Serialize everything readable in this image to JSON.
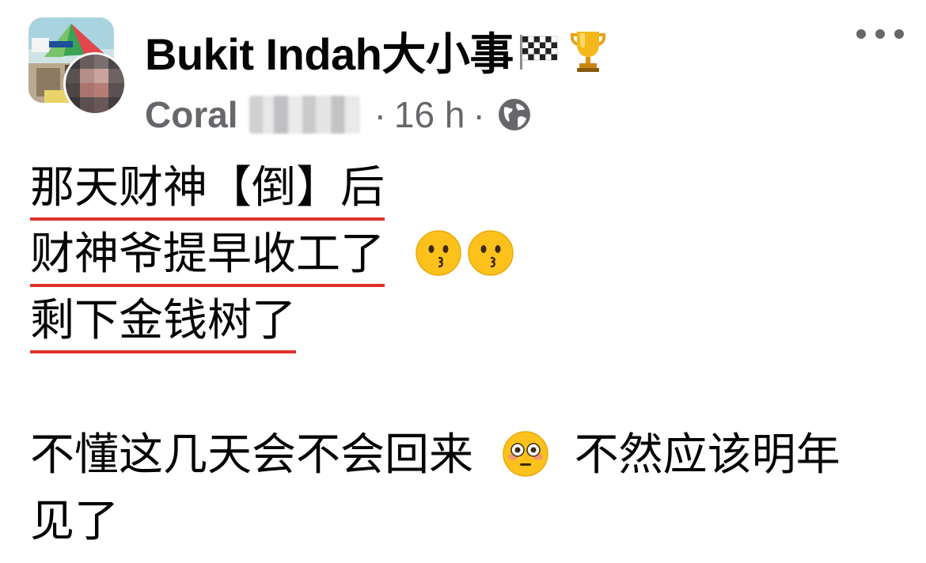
{
  "header": {
    "group_name": "Bukit Indah大小事",
    "author_first_name": "Coral",
    "timestamp": "16 h",
    "separator": "·",
    "icons": {
      "group_avatar": "group-avatar-image",
      "user_avatar": "user-avatar-blurred",
      "flag": "chequered-flag-emoji",
      "trophy": "trophy-emoji",
      "privacy": "globe-icon",
      "more": "more-options-icon"
    }
  },
  "post": {
    "lines": [
      "那天财神【倒】后",
      "财神爷提早收工了",
      "剩下金钱树了",
      "不懂这几天会不会回来",
      "不然应该明年",
      "见了"
    ],
    "emojis": {
      "line2": [
        "kissing-face-emoji",
        "kissing-face-emoji"
      ],
      "line4": "flushed-face-emoji"
    }
  },
  "colors": {
    "text": "#050505",
    "meta": "#65676b",
    "underline": "#e0302b",
    "background": "#ffffff"
  }
}
